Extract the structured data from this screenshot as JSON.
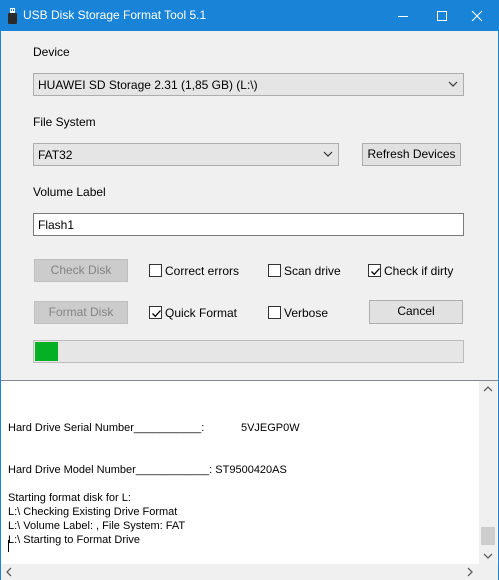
{
  "window": {
    "title": "USB Disk Storage Format Tool 5.1",
    "accent_color": "#1883d7",
    "icons": [
      "usb-icon",
      "minimize-icon",
      "maximize-icon",
      "close-icon"
    ]
  },
  "device": {
    "label": "Device",
    "selected": "HUAWEI  SD Storage  2.31 (1,85 GB) (L:\\)"
  },
  "file_system": {
    "label": "File System",
    "selected": "FAT32",
    "refresh_label": "Refresh Devices"
  },
  "volume": {
    "label": "Volume Label",
    "value": "Flash1"
  },
  "actions": {
    "check_disk_label": "Check Disk",
    "format_disk_label": "Format Disk",
    "cancel_label": "Cancel"
  },
  "options": {
    "correct_errors": {
      "label": "Correct errors",
      "checked": false
    },
    "scan_drive": {
      "label": "Scan drive",
      "checked": false
    },
    "check_if_dirty": {
      "label": "Check if dirty",
      "checked": true
    },
    "quick_format": {
      "label": "Quick Format",
      "checked": true
    },
    "verbose": {
      "label": "Verbose",
      "checked": false
    }
  },
  "progress": {
    "fraction": 0.055,
    "fill_color": "#06b025"
  },
  "log": {
    "text": "\n\nHard Drive Serial Number___________:            5VJEGP0W\n\n\nHard Drive Model Number____________: ST9500420AS\n\nStarting format disk for L:\nL:\\ Checking Existing Drive Format\nL:\\ Volume Label: , File System: FAT\nL:\\ Starting to Format Drive"
  }
}
